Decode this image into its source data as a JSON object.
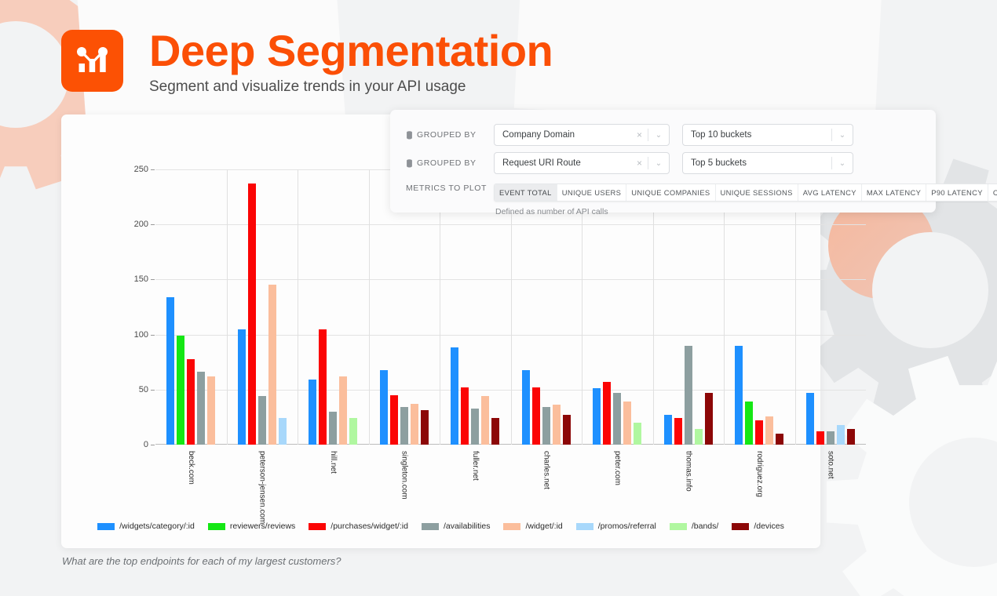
{
  "header": {
    "title": "Deep Segmentation",
    "subtitle": "Segment and visualize trends in your API usage",
    "logo_icon": "chart-logo-icon",
    "brand_color": "#fb4f06"
  },
  "panel": {
    "rows": [
      {
        "label": "GROUPED BY",
        "label_icon": "database-icon",
        "value": "Company Domain",
        "clear_icon": "×",
        "caret_icon": "⌄",
        "bucket_value": "Top 10 buckets",
        "bucket_caret_icon": "⌄"
      },
      {
        "label": "GROUPED BY",
        "label_icon": "database-icon",
        "value": "Request URI Route",
        "clear_icon": "×",
        "caret_icon": "⌄",
        "bucket_value": "Top 5 buckets",
        "bucket_caret_icon": "⌄"
      }
    ],
    "metrics_label": "METRICS TO PLOT",
    "metrics": [
      {
        "label": "EVENT TOTAL",
        "active": true
      },
      {
        "label": "UNIQUE USERS",
        "active": false
      },
      {
        "label": "UNIQUE COMPANIES",
        "active": false
      },
      {
        "label": "UNIQUE SESSIONS",
        "active": false
      },
      {
        "label": "AVG LATENCY",
        "active": false
      },
      {
        "label": "MAX LATENCY",
        "active": false
      },
      {
        "label": "P90 LATENCY",
        "active": false
      },
      {
        "label": "CUSTOM",
        "active": false
      }
    ],
    "metrics_hint": "Defined as number of API calls"
  },
  "caption": "What are the top endpoints for each of my largest customers?",
  "chart_data": {
    "type": "bar",
    "title": "",
    "xlabel": "",
    "ylabel": "",
    "ylim": [
      0,
      250
    ],
    "yticks": [
      0,
      50,
      100,
      150,
      200,
      250
    ],
    "grid": true,
    "legend_position": "bottom",
    "categories": [
      "beck.com",
      "peterson-jensen.com",
      "hill.net",
      "singleton.com",
      "fuller.net",
      "charles.net",
      "peter.com",
      "thomas.info",
      "rodriguez.org",
      "soto.net"
    ],
    "series": [
      {
        "name": "/widgets/category/:id",
        "color": "#1e90ff",
        "values": [
          134,
          105,
          59,
          68,
          88,
          68,
          51,
          27,
          90,
          47
        ]
      },
      {
        "name": "reviewers/reviews",
        "color": "#14e714",
        "values": [
          99,
          0,
          0,
          0,
          0,
          0,
          0,
          0,
          39,
          0
        ]
      },
      {
        "name": "/purchases/widget/:id",
        "color": "#fb0505",
        "values": [
          78,
          237,
          105,
          45,
          52,
          52,
          57,
          24,
          22,
          12
        ]
      },
      {
        "name": "/availabilities",
        "color": "#8d9fa0",
        "values": [
          66,
          44,
          30,
          34,
          33,
          34,
          47,
          90,
          0,
          12
        ]
      },
      {
        "name": "/widget/:id",
        "color": "#fbbe9c",
        "values": [
          62,
          145,
          62,
          37,
          44,
          36,
          39,
          0,
          26,
          0
        ]
      },
      {
        "name": "/promos/referral",
        "color": "#a8d8fb",
        "values": [
          0,
          24,
          0,
          0,
          0,
          0,
          0,
          0,
          0,
          18
        ]
      },
      {
        "name": "/bands/",
        "color": "#b0f7a0",
        "values": [
          0,
          0,
          24,
          0,
          0,
          0,
          20,
          14,
          0,
          0
        ]
      },
      {
        "name": "/devices",
        "color": "#8c0707",
        "values": [
          0,
          0,
          0,
          31,
          24,
          27,
          0,
          47,
          10,
          14
        ]
      }
    ]
  }
}
